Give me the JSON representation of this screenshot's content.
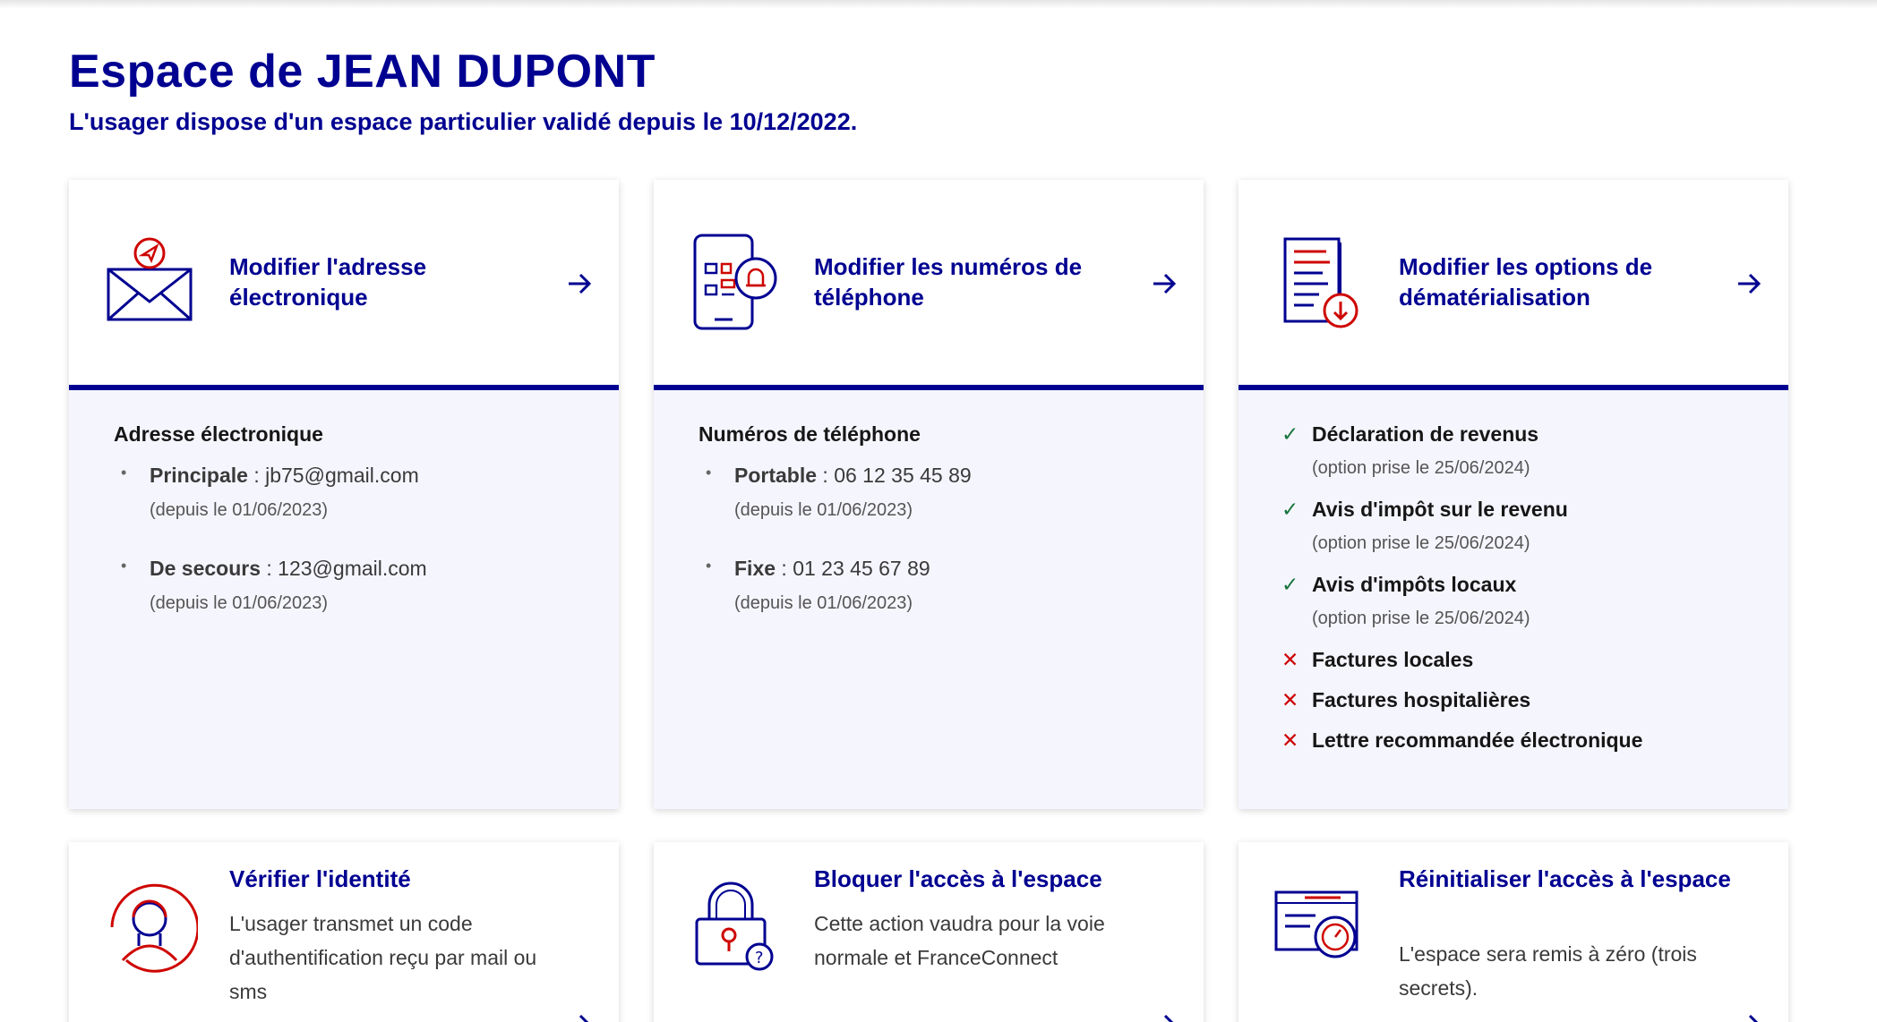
{
  "header": {
    "title": "Espace de JEAN DUPONT",
    "subtitle": "L'usager dispose d'un espace particulier validé depuis le 10/12/2022."
  },
  "colors": {
    "primary": "#000091",
    "accent": "#ce0500",
    "success": "#18753c",
    "panel": "#f5f5fe"
  },
  "email_card": {
    "icon": "envelope-icon",
    "link": "Modifier l'adresse électronique",
    "section_title": "Adresse électronique",
    "entries": [
      {
        "label": "Principale",
        "value": " : jb75@gmail.com",
        "since": "(depuis le 01/06/2023)"
      },
      {
        "label": "De secours",
        "value": " : 123@gmail.com",
        "since": "(depuis le 01/06/2023)"
      }
    ]
  },
  "phone_card": {
    "icon": "smartphone-icon",
    "link": "Modifier les numéros de téléphone",
    "section_title": "Numéros de téléphone",
    "entries": [
      {
        "label": "Portable",
        "value": " : 06 12 35 45 89",
        "since": "(depuis le 01/06/2023)"
      },
      {
        "label": "Fixe",
        "value": " : 01 23 45 67 89",
        "since": "(depuis le 01/06/2023)"
      }
    ]
  },
  "demat_card": {
    "icon": "document-download-icon",
    "link": "Modifier les options de dématérialisation",
    "options": [
      {
        "label": "Déclaration de revenus",
        "enabled": true,
        "since": "(option prise le 25/06/2024)"
      },
      {
        "label": "Avis d'impôt sur le revenu",
        "enabled": true,
        "since": "(option prise le 25/06/2024)"
      },
      {
        "label": "Avis d'impôts locaux",
        "enabled": true,
        "since": "(option prise le 25/06/2024)"
      },
      {
        "label": "Factures locales",
        "enabled": false
      },
      {
        "label": "Factures hospitalières",
        "enabled": false
      },
      {
        "label": "Lettre recommandée électronique",
        "enabled": false
      }
    ],
    "check_glyph": "✓",
    "cross_glyph": "✕"
  },
  "actions": [
    {
      "icon": "identity-icon",
      "title": "Vérifier l'identité",
      "desc": "L'usager transmet un code d'authentification reçu par mail ou sms"
    },
    {
      "icon": "padlock-icon",
      "title": "Bloquer l'accès à l'espace",
      "desc": "Cette action vaudra pour la voie normale et FranceConnect"
    },
    {
      "icon": "reset-icon",
      "title": "Réinitialiser l'accès à l'espace",
      "desc": "L'espace sera remis à zéro (trois secrets)."
    }
  ],
  "bullet_glyph": "•"
}
